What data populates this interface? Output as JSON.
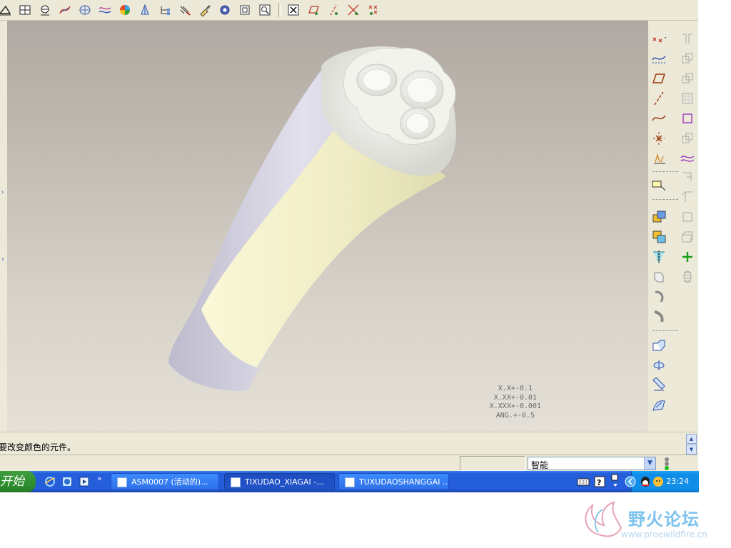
{
  "top_toolbar": {
    "icons": [
      "datum-plane-icon",
      "grid-icon",
      "measure-icon",
      "curve-analysis-icon",
      "surface-analysis-icon",
      "curvature-icon",
      "shade-icon",
      "draft-check-icon",
      "model-tree-icon",
      "reference-icon",
      "feature-icon",
      "settings-gear-icon",
      "window-icon",
      "zoom-icon",
      "close-x-icon",
      "plane-display-icon",
      "axis-display-icon",
      "point-display-icon",
      "csys-display-icon"
    ]
  },
  "viewport": {
    "tolerances": [
      "X.X+-0.1",
      "X.XX+-0.01",
      "X.XXX+-0.001",
      "ANG.+-0.5"
    ],
    "colors": {
      "bg_top": "#afa9a2",
      "bg_bottom": "#e4e0d7",
      "part_white": "#eeeee8",
      "part_cream": "#f3f0c8",
      "part_lilac": "#d8d6e4"
    }
  },
  "right_toolbar": {
    "column_a": [
      "datum-point-icon",
      "sketch-curve-icon",
      "datum-plane-icon",
      "datum-axis-icon",
      "datum-curve-icon",
      "csys-icon",
      "analysis-icon",
      "annotation-icon",
      "copy-icon",
      "paste-icon",
      "mirror-icon",
      "extrude-icon",
      "revolve-icon",
      "sweep-icon",
      "round-icon",
      "draft-icon",
      "offset-icon",
      "trim-icon"
    ],
    "column_b": [
      "mirror-gray-icon",
      "copy-gray-icon",
      "copy-gray-icon-2",
      "pattern-gray-icon",
      "sketch-purple-icon",
      "copy-gray-icon-3",
      "surface-purple-icon",
      "dimension-gray-icon",
      "chamfer-gray-icon",
      "shell-gray-icon",
      "box-gray-icon",
      "add-green-icon",
      "spring-gray-icon"
    ]
  },
  "message": {
    "text": "要改变颜色的元件。"
  },
  "status": {
    "filter_value": "智能"
  },
  "taskbar": {
    "start_label": "开始",
    "quick_launch": [
      "ie-icon",
      "ie2-icon",
      "media-icon"
    ],
    "chevron": "»",
    "tasks": [
      {
        "label": "ASM0007 (活动的)...",
        "active": false
      },
      {
        "label": "TIXUDAO_XIAGAI -...",
        "active": true
      },
      {
        "label": "TUXUDAOSHANGGAI ...",
        "active": false
      }
    ],
    "clock": "23:24",
    "accent": "#245edb"
  },
  "watermark": {
    "text": "野火论坛",
    "url": "www.proewildfire.cn"
  }
}
